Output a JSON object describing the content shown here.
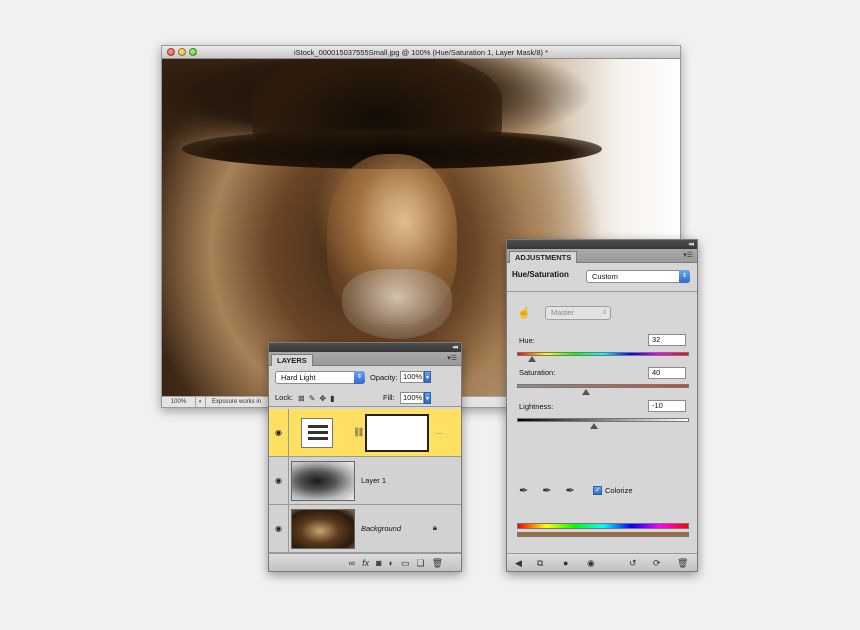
{
  "document": {
    "title": "iStock_000015037555Small.jpg @ 100% (Hue/Saturation 1, Layer Mask/8) *",
    "zoom": "100%",
    "status": "Exposure works in"
  },
  "layers_panel": {
    "tab": "LAYERS",
    "blend_mode": "Hard Light",
    "opacity_label": "Opacity:",
    "opacity_value": "100%",
    "lock_label": "Lock:",
    "fill_label": "Fill:",
    "fill_value": "100%",
    "layers": [
      {
        "name": "",
        "type": "adjustment",
        "active": true
      },
      {
        "name": "Layer 1",
        "type": "pixel",
        "active": false
      },
      {
        "name": "Background",
        "type": "background",
        "active": false
      }
    ]
  },
  "adjustments_panel": {
    "tab": "ADJUSTMENTS",
    "title": "Hue/Saturation",
    "preset": "Custom",
    "channel": "Master",
    "hue_label": "Hue:",
    "hue_value": "32",
    "hue": 32,
    "saturation_label": "Saturation:",
    "saturation_value": "40",
    "saturation": 40,
    "lightness_label": "Lightness:",
    "lightness_value": "-10",
    "lightness": -10,
    "colorize_label": "Colorize",
    "colorize_checked": true
  },
  "colors": {
    "active_layer": "#ffe061",
    "select_accent": "#2d6bd0",
    "result_bar": "#a06a3b"
  }
}
